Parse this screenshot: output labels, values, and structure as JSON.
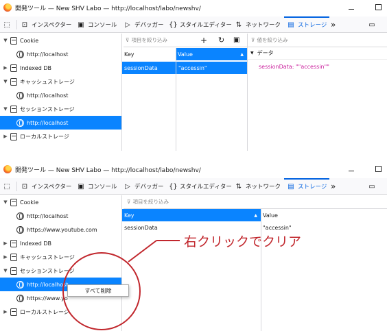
{
  "window_title": "開発ツール — New SHV Labo — http://localhost/labo/newshv/",
  "toolbar": {
    "pick_icon": "pick-element-icon",
    "tabs": [
      {
        "label": "インスペクター",
        "icon": "inspector-icon"
      },
      {
        "label": "コンソール",
        "icon": "console-icon"
      },
      {
        "label": "デバッガー",
        "icon": "debugger-icon"
      },
      {
        "label": "スタイルエディター",
        "icon": "style-editor-icon"
      },
      {
        "label": "ネットワーク",
        "icon": "network-icon"
      },
      {
        "label": "ストレージ",
        "icon": "storage-icon",
        "selected": true
      }
    ],
    "more": "»"
  },
  "panel1": {
    "tree": [
      {
        "label": "Cookie",
        "level": "parent",
        "expanded": true
      },
      {
        "label": "http://localhost",
        "level": "child"
      },
      {
        "label": "Indexed DB",
        "level": "parent",
        "expanded": false
      },
      {
        "label": "キャッシュストレージ",
        "level": "parent",
        "expanded": true
      },
      {
        "label": "http://localhost",
        "level": "child"
      },
      {
        "label": "セッションストレージ",
        "level": "parent",
        "expanded": true
      },
      {
        "label": "http://localhost",
        "level": "child",
        "selected": true
      },
      {
        "label": "ローカルストレージ",
        "level": "parent",
        "expanded": false
      }
    ],
    "filter_placeholder": "項目を絞り込み",
    "value_filter_placeholder": "値を絞り込み",
    "columns": [
      "Key",
      "Value"
    ],
    "rows": [
      {
        "key": "sessionData",
        "value": "\"accessin\""
      }
    ],
    "data_header": "データ",
    "data_entry": "sessionData: \"\"accessin\"\""
  },
  "panel2": {
    "tree": [
      {
        "label": "Cookie",
        "level": "parent",
        "expanded": true
      },
      {
        "label": "http://localhost",
        "level": "child"
      },
      {
        "label": "https://www.youtube.com",
        "level": "child"
      },
      {
        "label": "Indexed DB",
        "level": "parent",
        "expanded": false
      },
      {
        "label": "キャッシュストレージ",
        "level": "parent",
        "expanded": false
      },
      {
        "label": "セッションストレージ",
        "level": "parent",
        "expanded": true
      },
      {
        "label": "http://localhost",
        "level": "child",
        "selected": true
      },
      {
        "label": "https://www.yo",
        "level": "child"
      },
      {
        "label": "ローカルストレージ",
        "level": "parent",
        "expanded": false
      }
    ],
    "filter_placeholder": "項目を絞り込み",
    "columns": [
      "Key",
      "Value"
    ],
    "rows": [
      {
        "key": "sessionData",
        "value": "\"accessin\""
      }
    ],
    "context_menu": "すべて削除"
  },
  "annotation": {
    "text": "右クリックでクリア",
    "color": "#c1272d"
  },
  "colors": {
    "selection": "#0a84ff",
    "tab_active": "#0061e0",
    "data_key": "#c91c9b"
  }
}
